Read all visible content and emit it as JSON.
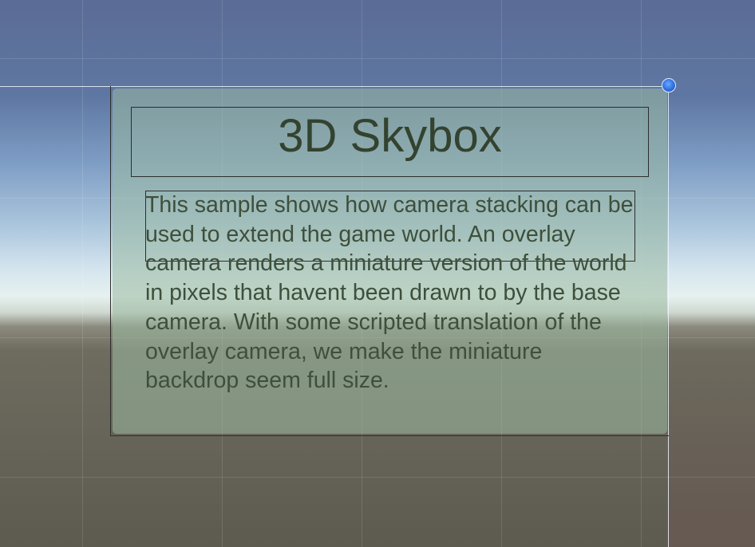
{
  "scene": {
    "title": "3D Skybox",
    "description": "This sample shows how camera stacking can be used to extend the game world. An overlay camera renders a miniature version of the world in pixels that havent been drawn to by the base camera. With some scripted translation of the overlay camera, we make the miniature backdrop seem full size."
  },
  "colors": {
    "sky_top": "#5b6c96",
    "horizon": "#e6f1ef",
    "ground": "#5d5b50",
    "panel": "#9bb9a0",
    "title_text": "#33432f",
    "body_text": "#3e4f3b",
    "handle": "#2f6fe0"
  },
  "icons": {
    "rect_handle": "rect-transform-handle-icon"
  }
}
